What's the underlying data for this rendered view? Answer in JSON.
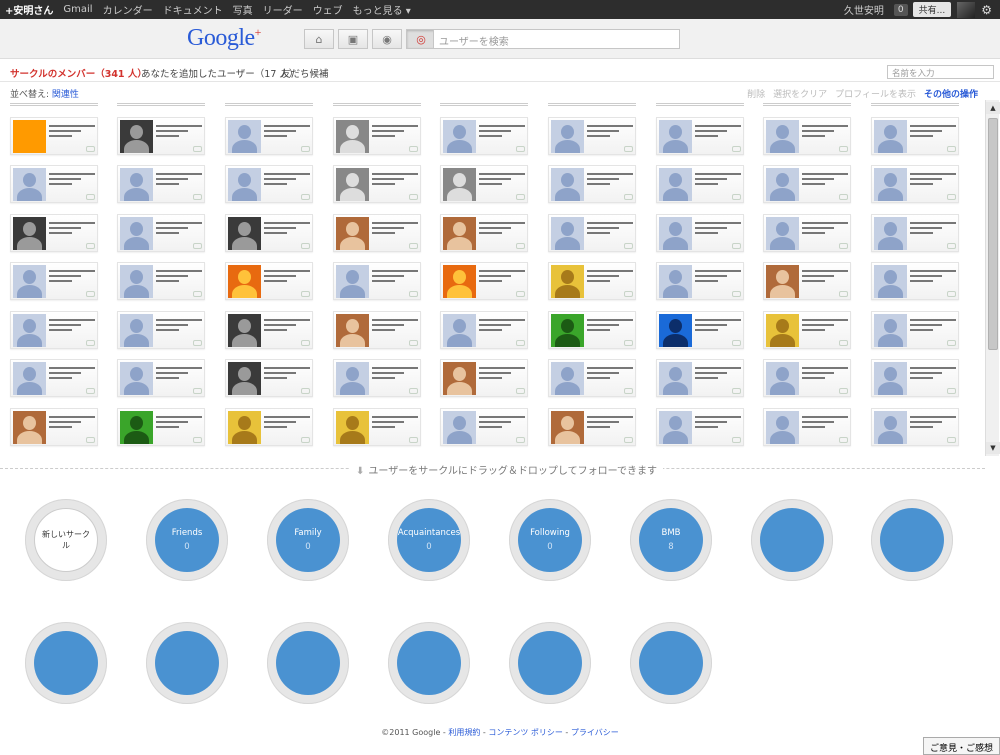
{
  "gbar": {
    "user_short": "+安明さん",
    "links": [
      "Gmail",
      "カレンダー",
      "ドキュメント",
      "写真",
      "リーダー",
      "ウェブ",
      "もっと見る ▾"
    ],
    "account_name": "久世安明",
    "notification_count": "0",
    "share_label": "共有..."
  },
  "header": {
    "logo_google": "Google",
    "logo_plus": "+",
    "search_placeholder": "ユーザーを検索"
  },
  "tabs": {
    "members": "サークルのメンバー（341 人）",
    "added_you": "あなたを追加したユーザー（17 人）",
    "suggestions": "友だち候補",
    "name_filter_placeholder": "名前を入力"
  },
  "sort": {
    "label": "並べ替え: ",
    "value": "関連性"
  },
  "actions": {
    "delete": "削除",
    "clear": "選択をクリア",
    "profile": "プロフィールを表示",
    "more": "その他の操作"
  },
  "drag_hint": "ユーザーをサークルにドラッグ＆ドロップしてフォローできます",
  "circles": [
    {
      "name": "新しいサークル",
      "count": ""
    },
    {
      "name": "Friends",
      "count": "0"
    },
    {
      "name": "Family",
      "count": "0"
    },
    {
      "name": "Acquaintances",
      "count": "0"
    },
    {
      "name": "Following",
      "count": "0"
    },
    {
      "name": "BMB",
      "count": "8"
    }
  ],
  "footer": {
    "copyright": "©2011 Google - ",
    "terms": "利用規約",
    "content_policy": "コンテンツ ポリシー",
    "privacy": "プライバシー"
  },
  "feedback": "ご意見・ご感想"
}
